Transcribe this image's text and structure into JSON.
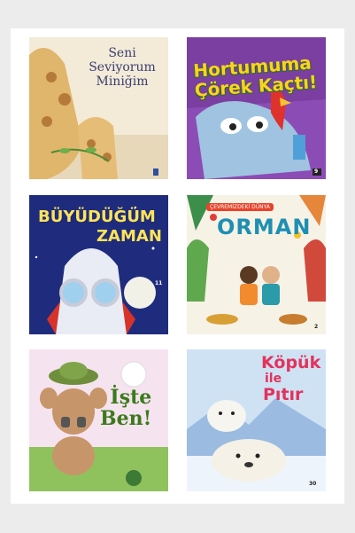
{
  "books": [
    {
      "id": "b1",
      "title_lines": [
        "Seni",
        "Seviyorum",
        "Miniğim"
      ]
    },
    {
      "id": "b2",
      "title_lines": [
        "Hortumuma",
        "Çörek Kaçtı!"
      ],
      "number": "9"
    },
    {
      "id": "b3",
      "title_lines": [
        "BÜYÜDÜĞÜM",
        "ZAMAN"
      ],
      "number": "11"
    },
    {
      "id": "b4",
      "series_banner": "ÇEVREMİZDEKİ DÜNYA",
      "title_lines": [
        "ORMAN"
      ],
      "number": "2"
    },
    {
      "id": "b5",
      "title_lines": [
        "İşte",
        "Ben!"
      ]
    },
    {
      "id": "b6",
      "title_lines": [
        "Köpük",
        "ile",
        "Pıtır"
      ],
      "number": "30"
    }
  ]
}
